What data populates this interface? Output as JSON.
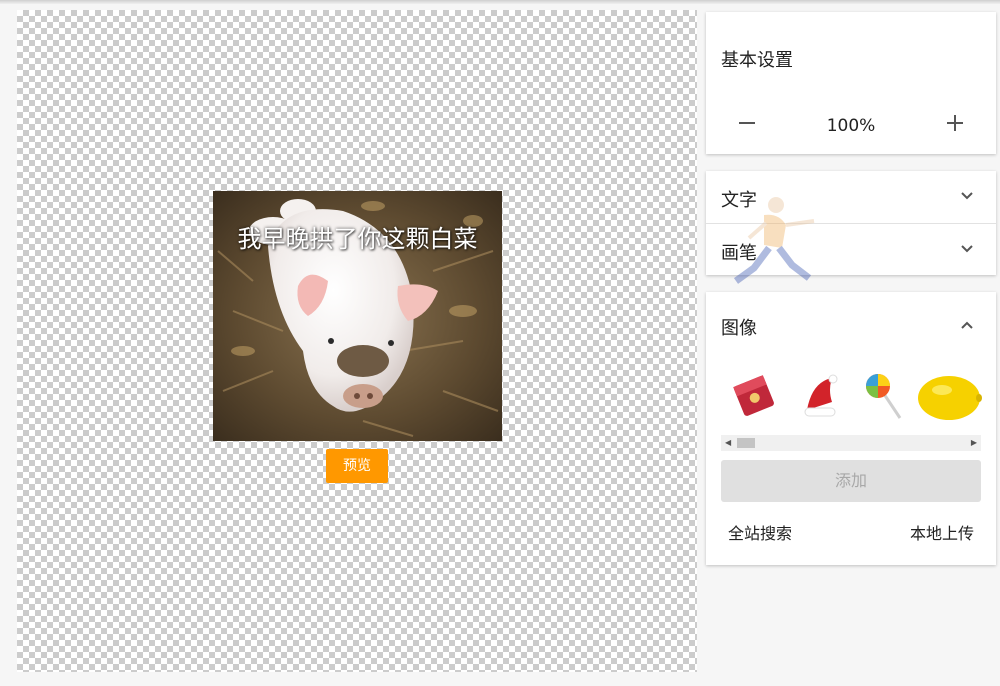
{
  "canvas": {
    "meme_caption": "我早晚拱了你这颗白菜",
    "preview_label": "预览"
  },
  "basic_settings": {
    "title": "基本设置",
    "zoom": "100%",
    "zoom_out_icon": "minus-icon",
    "zoom_in_icon": "plus-icon"
  },
  "accordions": {
    "text_label": "文字",
    "pen_label": "画笔",
    "text_icon": "chevron-down-icon",
    "pen_icon": "chevron-down-icon"
  },
  "image_panel": {
    "title": "图像",
    "toggle_icon": "chevron-up-icon",
    "stickers": [
      "red-packet-sticker",
      "santa-hat-sticker",
      "lollipop-sticker",
      "lemon-sticker"
    ],
    "add_label": "添加",
    "search_label": "全站搜索",
    "upload_label": "本地上传"
  },
  "colors": {
    "accent": "#ff9800",
    "disabled_bg": "#e0e0e0",
    "disabled_text": "#a8a8a8"
  }
}
